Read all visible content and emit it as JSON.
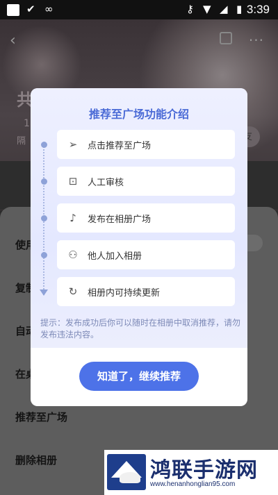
{
  "status_bar": {
    "time": "3:39"
  },
  "album_page": {
    "title": "共",
    "count": "1",
    "subtitle": "隔",
    "friend_button": "友"
  },
  "sheet": {
    "items": [
      "使用",
      "复制",
      "自动",
      "在桌",
      "推荐至广场",
      "删除相册"
    ]
  },
  "modal": {
    "title": "推荐至广场功能介绍",
    "steps": [
      {
        "icon": "paper-plane-icon",
        "label": "点击推荐至广场"
      },
      {
        "icon": "review-icon",
        "label": "人工审核"
      },
      {
        "icon": "music-note-icon",
        "label": "发布在相册广场"
      },
      {
        "icon": "users-icon",
        "label": "他人加入相册"
      },
      {
        "icon": "refresh-icon",
        "label": "相册内可持续更新"
      }
    ],
    "tip": "提示：发布成功后你可以随时在相册中取消推荐，请勿发布违法内容。",
    "confirm_button": "知道了，继续推荐"
  },
  "watermark": {
    "text": "鸿联手游网",
    "url": "www.henanhonglian95.com"
  },
  "colors": {
    "accent": "#4d72e8",
    "title": "#4a6ad6"
  }
}
